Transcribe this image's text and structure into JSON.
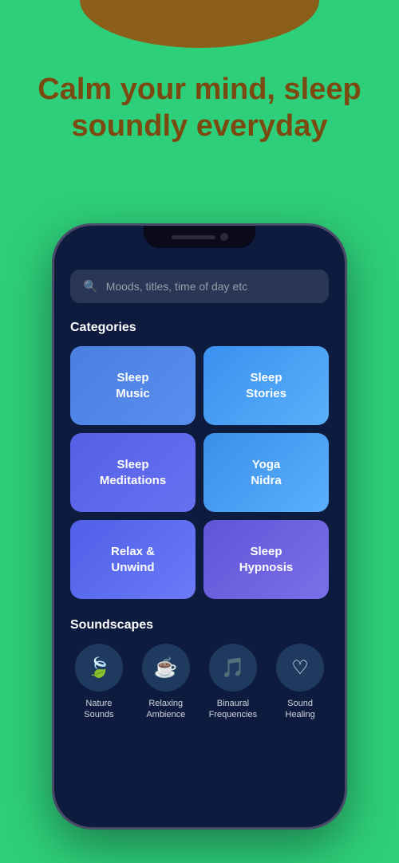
{
  "hero": {
    "title": "Calm your mind, sleep soundly everyday"
  },
  "screen": {
    "search": {
      "placeholder": "Moods, titles, time of day etc"
    },
    "categories_title": "Categories",
    "categories": [
      {
        "id": "sleep-music",
        "label": "Sleep\nMusic",
        "style": "cat-sleep-music"
      },
      {
        "id": "sleep-stories",
        "label": "Sleep\nStories",
        "style": "cat-sleep-stories"
      },
      {
        "id": "sleep-meditations",
        "label": "Sleep\nMeditations",
        "style": "cat-sleep-meditations"
      },
      {
        "id": "yoga-nidra",
        "label": "Yoga\nNidra",
        "style": "cat-yoga-nidra"
      },
      {
        "id": "relax-unwind",
        "label": "Relax &\nUnwind",
        "style": "cat-relax-unwind"
      },
      {
        "id": "sleep-hypnosis",
        "label": "Sleep\nHypnosis",
        "style": "cat-sleep-hypnosis"
      }
    ],
    "soundscapes_title": "Soundscapes",
    "soundscapes": [
      {
        "id": "nature-sounds",
        "icon": "🍃",
        "label": "Nature\nSounds"
      },
      {
        "id": "relaxing-ambience",
        "icon": "☕",
        "label": "Relaxing\nAmbience"
      },
      {
        "id": "binaural-frequencies",
        "icon": "🎵",
        "label": "Binaural\nFrequencies"
      },
      {
        "id": "sound-healing",
        "icon": "❤",
        "label": "Sound\nHealing"
      }
    ]
  }
}
